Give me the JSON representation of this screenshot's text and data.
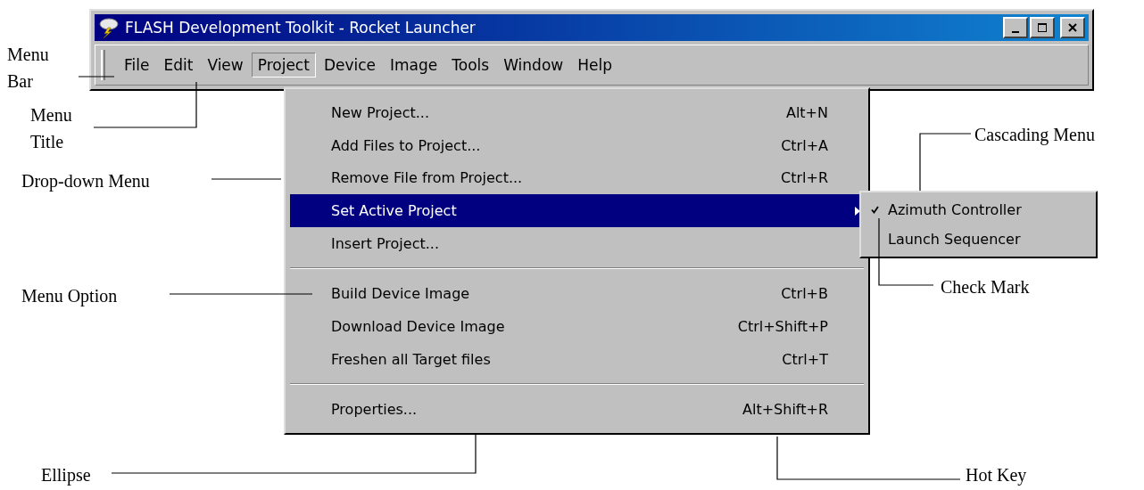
{
  "window": {
    "title": "FLASH Development Toolkit - Rocket Launcher"
  },
  "menu_bar": [
    {
      "label": "File",
      "selected": false
    },
    {
      "label": "Edit",
      "selected": false
    },
    {
      "label": "View",
      "selected": false
    },
    {
      "label": "Project",
      "selected": true
    },
    {
      "label": "Device",
      "selected": false
    },
    {
      "label": "Image",
      "selected": false
    },
    {
      "label": "Tools",
      "selected": false
    },
    {
      "label": "Window",
      "selected": false
    },
    {
      "label": "Help",
      "selected": false
    }
  ],
  "dropdown_menu": {
    "items": [
      {
        "kind": "item",
        "label": "New Project...",
        "shortcut": "Alt+N",
        "selected": false
      },
      {
        "kind": "item",
        "label": "Add Files to Project...",
        "shortcut": "Ctrl+A",
        "selected": false
      },
      {
        "kind": "item",
        "label": "Remove File from Project...",
        "shortcut": "Ctrl+R",
        "selected": false
      },
      {
        "kind": "submenu",
        "label": "Set Active Project",
        "selected": true
      },
      {
        "kind": "item",
        "label": "Insert Project...",
        "selected": false
      },
      {
        "kind": "separator"
      },
      {
        "kind": "item",
        "label": "Build Device Image",
        "shortcut": "Ctrl+B",
        "selected": false
      },
      {
        "kind": "item",
        "label": "Download Device Image",
        "shortcut": "Ctrl+Shift+P",
        "selected": false
      },
      {
        "kind": "item",
        "label": "Freshen all Target files",
        "shortcut": "Ctrl+T",
        "selected": false
      },
      {
        "kind": "separator"
      },
      {
        "kind": "item",
        "label": "Properties...",
        "shortcut": "Alt+Shift+R",
        "selected": false
      }
    ]
  },
  "cascading_menu": {
    "items": [
      {
        "label": "Azimuth Controller",
        "checked": true
      },
      {
        "label": "Launch Sequencer",
        "checked": false
      }
    ]
  },
  "annotations": [
    {
      "text": "Menu Bar"
    },
    {
      "text": "Menu Title"
    },
    {
      "text": "Cascading Menu"
    },
    {
      "text": "Drop-down Menu"
    },
    {
      "text": "Check Mark"
    },
    {
      "text": "Menu Option"
    },
    {
      "text": "Ellipse"
    },
    {
      "text": "Hot Key"
    }
  ]
}
